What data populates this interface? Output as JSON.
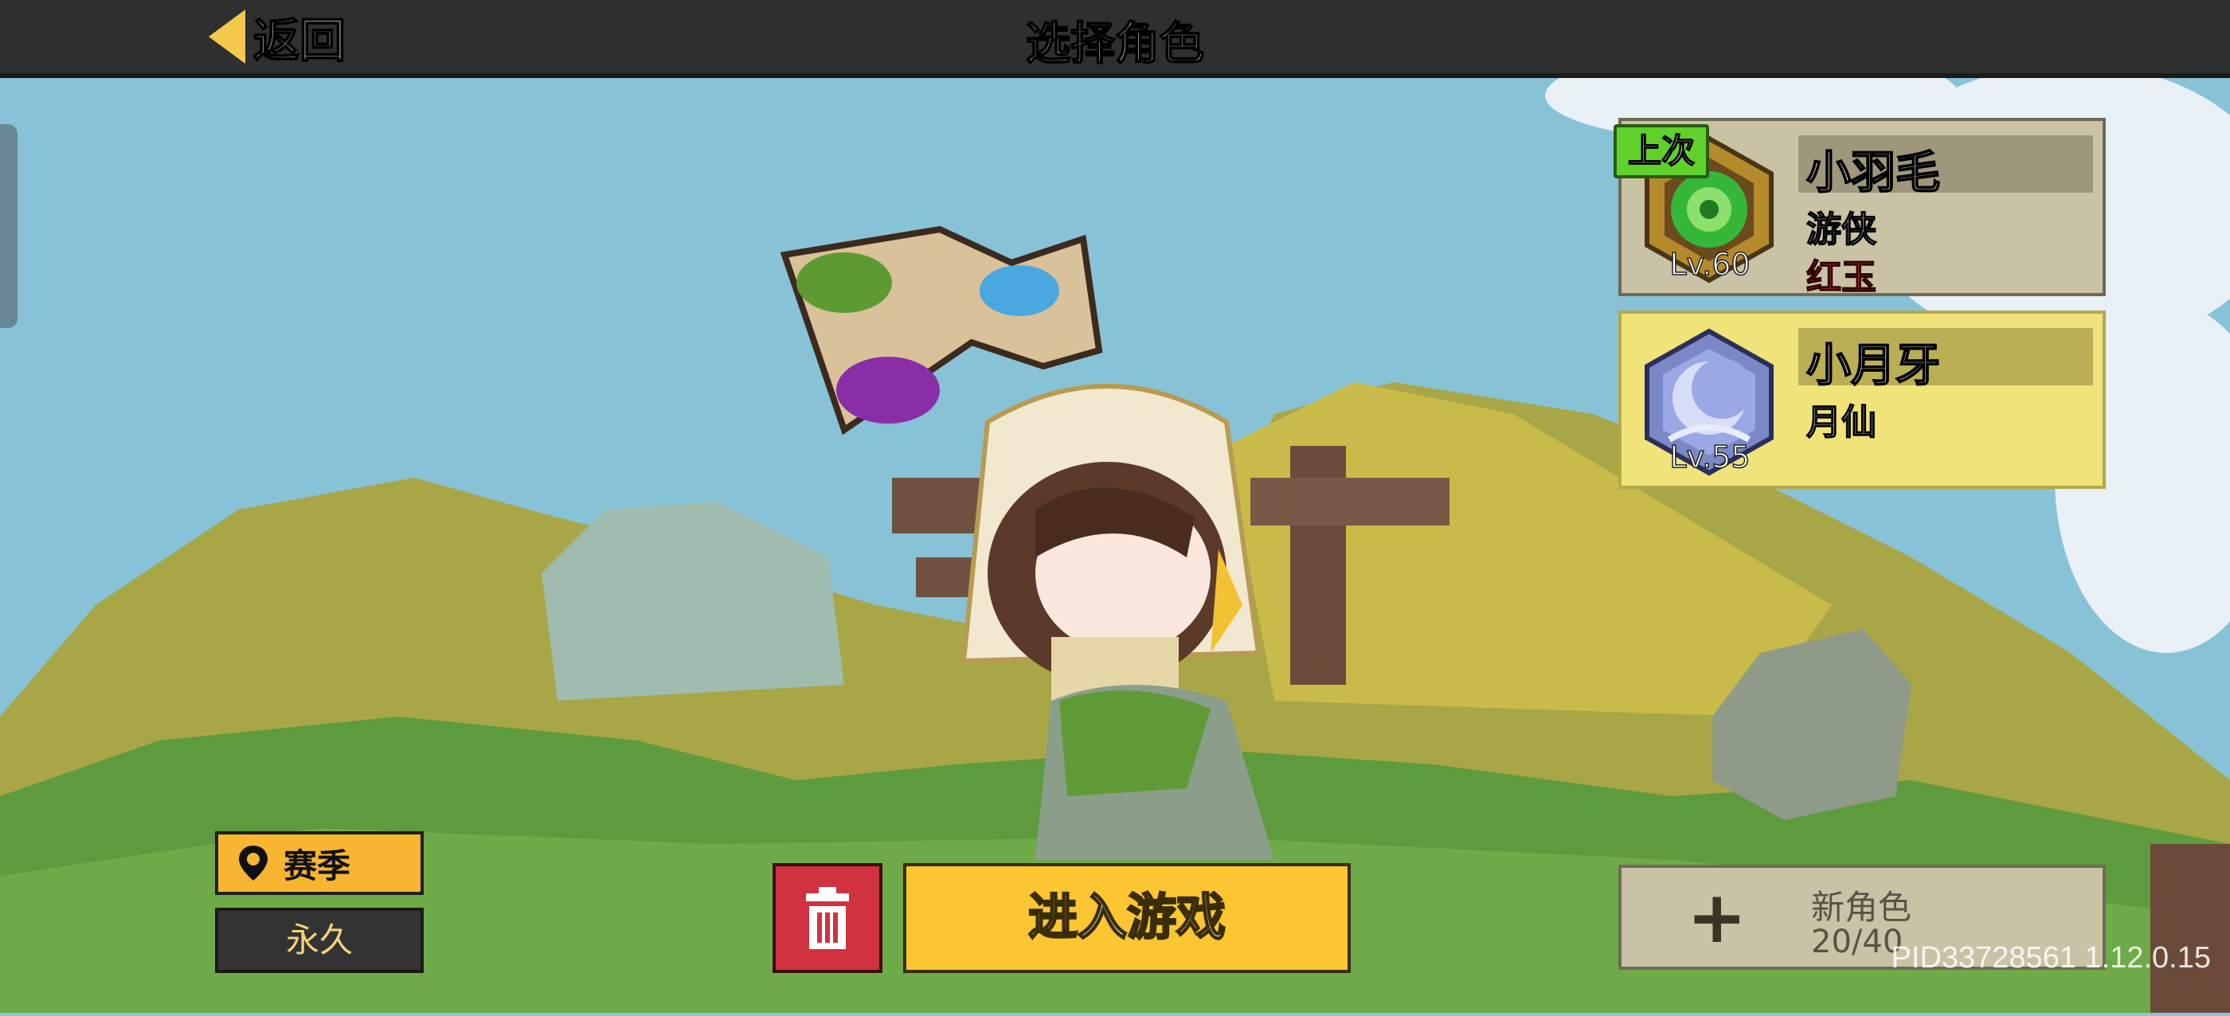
{
  "header": {
    "back_label": "返回",
    "title": "选择角色"
  },
  "characters": [
    {
      "badge": "上次",
      "name": "小羽毛",
      "class": "游侠",
      "server": "红玉",
      "level": "Lv.60",
      "selected": false
    },
    {
      "name": "小月牙",
      "class": "月仙",
      "level": "Lv.55",
      "selected": true
    }
  ],
  "new_role": {
    "icon": "+",
    "label": "新角色",
    "count": "20/40"
  },
  "mode_buttons": {
    "season": "赛季",
    "permanent": "永久"
  },
  "actions": {
    "enter_game": "进入游戏"
  },
  "footer": {
    "version": "PID33728561 1.12.0.15"
  },
  "colors": {
    "accent_yellow": "#fbc631",
    "delete_red": "#d0323f",
    "season_orange": "#f7b531",
    "last_badge_green": "#5fd12a"
  }
}
